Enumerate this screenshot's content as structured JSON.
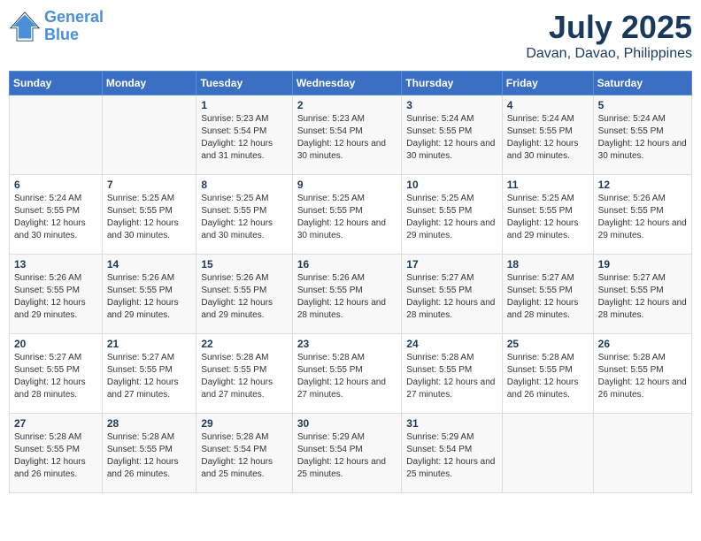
{
  "header": {
    "logo_line1": "General",
    "logo_line2": "Blue",
    "main_title": "July 2025",
    "subtitle": "Davan, Davao, Philippines"
  },
  "calendar": {
    "days_of_week": [
      "Sunday",
      "Monday",
      "Tuesday",
      "Wednesday",
      "Thursday",
      "Friday",
      "Saturday"
    ],
    "weeks": [
      [
        {
          "day": "",
          "info": ""
        },
        {
          "day": "",
          "info": ""
        },
        {
          "day": "1",
          "info": "Sunrise: 5:23 AM\nSunset: 5:54 PM\nDaylight: 12 hours and 31 minutes."
        },
        {
          "day": "2",
          "info": "Sunrise: 5:23 AM\nSunset: 5:54 PM\nDaylight: 12 hours and 30 minutes."
        },
        {
          "day": "3",
          "info": "Sunrise: 5:24 AM\nSunset: 5:55 PM\nDaylight: 12 hours and 30 minutes."
        },
        {
          "day": "4",
          "info": "Sunrise: 5:24 AM\nSunset: 5:55 PM\nDaylight: 12 hours and 30 minutes."
        },
        {
          "day": "5",
          "info": "Sunrise: 5:24 AM\nSunset: 5:55 PM\nDaylight: 12 hours and 30 minutes."
        }
      ],
      [
        {
          "day": "6",
          "info": "Sunrise: 5:24 AM\nSunset: 5:55 PM\nDaylight: 12 hours and 30 minutes."
        },
        {
          "day": "7",
          "info": "Sunrise: 5:25 AM\nSunset: 5:55 PM\nDaylight: 12 hours and 30 minutes."
        },
        {
          "day": "8",
          "info": "Sunrise: 5:25 AM\nSunset: 5:55 PM\nDaylight: 12 hours and 30 minutes."
        },
        {
          "day": "9",
          "info": "Sunrise: 5:25 AM\nSunset: 5:55 PM\nDaylight: 12 hours and 30 minutes."
        },
        {
          "day": "10",
          "info": "Sunrise: 5:25 AM\nSunset: 5:55 PM\nDaylight: 12 hours and 29 minutes."
        },
        {
          "day": "11",
          "info": "Sunrise: 5:25 AM\nSunset: 5:55 PM\nDaylight: 12 hours and 29 minutes."
        },
        {
          "day": "12",
          "info": "Sunrise: 5:26 AM\nSunset: 5:55 PM\nDaylight: 12 hours and 29 minutes."
        }
      ],
      [
        {
          "day": "13",
          "info": "Sunrise: 5:26 AM\nSunset: 5:55 PM\nDaylight: 12 hours and 29 minutes."
        },
        {
          "day": "14",
          "info": "Sunrise: 5:26 AM\nSunset: 5:55 PM\nDaylight: 12 hours and 29 minutes."
        },
        {
          "day": "15",
          "info": "Sunrise: 5:26 AM\nSunset: 5:55 PM\nDaylight: 12 hours and 29 minutes."
        },
        {
          "day": "16",
          "info": "Sunrise: 5:26 AM\nSunset: 5:55 PM\nDaylight: 12 hours and 28 minutes."
        },
        {
          "day": "17",
          "info": "Sunrise: 5:27 AM\nSunset: 5:55 PM\nDaylight: 12 hours and 28 minutes."
        },
        {
          "day": "18",
          "info": "Sunrise: 5:27 AM\nSunset: 5:55 PM\nDaylight: 12 hours and 28 minutes."
        },
        {
          "day": "19",
          "info": "Sunrise: 5:27 AM\nSunset: 5:55 PM\nDaylight: 12 hours and 28 minutes."
        }
      ],
      [
        {
          "day": "20",
          "info": "Sunrise: 5:27 AM\nSunset: 5:55 PM\nDaylight: 12 hours and 28 minutes."
        },
        {
          "day": "21",
          "info": "Sunrise: 5:27 AM\nSunset: 5:55 PM\nDaylight: 12 hours and 27 minutes."
        },
        {
          "day": "22",
          "info": "Sunrise: 5:28 AM\nSunset: 5:55 PM\nDaylight: 12 hours and 27 minutes."
        },
        {
          "day": "23",
          "info": "Sunrise: 5:28 AM\nSunset: 5:55 PM\nDaylight: 12 hours and 27 minutes."
        },
        {
          "day": "24",
          "info": "Sunrise: 5:28 AM\nSunset: 5:55 PM\nDaylight: 12 hours and 27 minutes."
        },
        {
          "day": "25",
          "info": "Sunrise: 5:28 AM\nSunset: 5:55 PM\nDaylight: 12 hours and 26 minutes."
        },
        {
          "day": "26",
          "info": "Sunrise: 5:28 AM\nSunset: 5:55 PM\nDaylight: 12 hours and 26 minutes."
        }
      ],
      [
        {
          "day": "27",
          "info": "Sunrise: 5:28 AM\nSunset: 5:55 PM\nDaylight: 12 hours and 26 minutes."
        },
        {
          "day": "28",
          "info": "Sunrise: 5:28 AM\nSunset: 5:55 PM\nDaylight: 12 hours and 26 minutes."
        },
        {
          "day": "29",
          "info": "Sunrise: 5:28 AM\nSunset: 5:54 PM\nDaylight: 12 hours and 25 minutes."
        },
        {
          "day": "30",
          "info": "Sunrise: 5:29 AM\nSunset: 5:54 PM\nDaylight: 12 hours and 25 minutes."
        },
        {
          "day": "31",
          "info": "Sunrise: 5:29 AM\nSunset: 5:54 PM\nDaylight: 12 hours and 25 minutes."
        },
        {
          "day": "",
          "info": ""
        },
        {
          "day": "",
          "info": ""
        }
      ]
    ]
  }
}
